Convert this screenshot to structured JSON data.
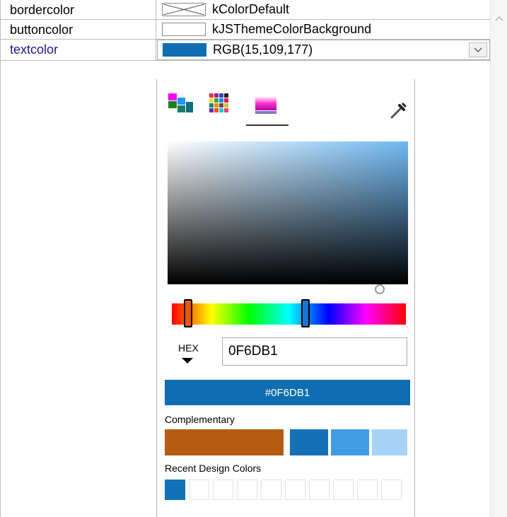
{
  "properties": [
    {
      "name": "bordercolor",
      "value": "kColorDefault",
      "swatch": "none"
    },
    {
      "name": "buttoncolor",
      "value": "kJSThemeColorBackground",
      "swatch": "#ffffff"
    },
    {
      "name": "textcolor",
      "value": "RGB(15,109,177)",
      "swatch": "#0F6DB1",
      "name_color": "#1a1a8c"
    }
  ],
  "picker": {
    "tabs": [
      "palette-grid-icon",
      "swatches-grid-icon",
      "gradient-icon"
    ],
    "active_tab": "gradient-icon",
    "hue_thumbs_fraction": [
      0.07,
      0.57
    ],
    "hex_label": "HEX",
    "hex_value": "0F6DB1",
    "preview_text": "#0F6DB1",
    "preview_color": "#0F6DB1",
    "complementary_label": "Complementary",
    "complementary_colors": [
      "#B55C12",
      "#1670B7",
      "#429CE1",
      "#A6D2F6"
    ],
    "recent_label": "Recent Design Colors",
    "recent_colors": [
      "#1272B8",
      "",
      "",
      "",
      "",
      "",
      "",
      "",
      "",
      ""
    ]
  },
  "colors": {
    "accent": "#0F6DB1",
    "grid_line": "#bcbcbc"
  }
}
